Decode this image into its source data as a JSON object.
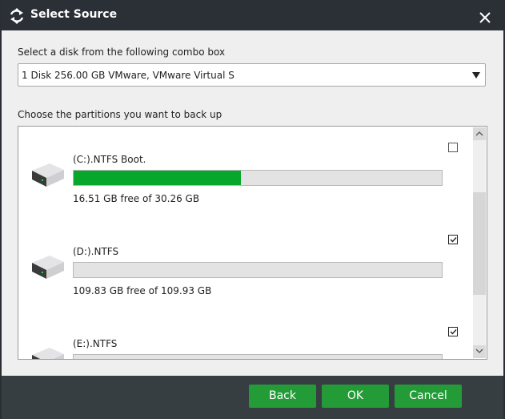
{
  "window": {
    "title": "Select Source",
    "icon": "backup-arrows-icon",
    "close_icon": "close-icon"
  },
  "disk_select": {
    "label": "Select a disk from the following combo box",
    "selected": "1 Disk 256.00 GB VMware,  VMware Virtual S"
  },
  "partitions": {
    "label": "Choose the partitions you want to back up",
    "items": [
      {
        "name": "(C:).NTFS Boot.",
        "free_text": "16.51 GB free of 30.26 GB",
        "used_percent": 45.4,
        "checked": false
      },
      {
        "name": "(D:).NTFS",
        "free_text": "109.83 GB free of 109.93 GB",
        "used_percent": 0.1,
        "checked": true
      },
      {
        "name": "(E:).NTFS",
        "free_text": "",
        "used_percent": 0,
        "checked": true
      }
    ]
  },
  "buttons": {
    "back": "Back",
    "ok": "OK",
    "cancel": "Cancel"
  },
  "colors": {
    "titlebar": "#2b3036",
    "footer": "#373e42",
    "button": "#239b37",
    "usage_fill": "#06a72a"
  }
}
